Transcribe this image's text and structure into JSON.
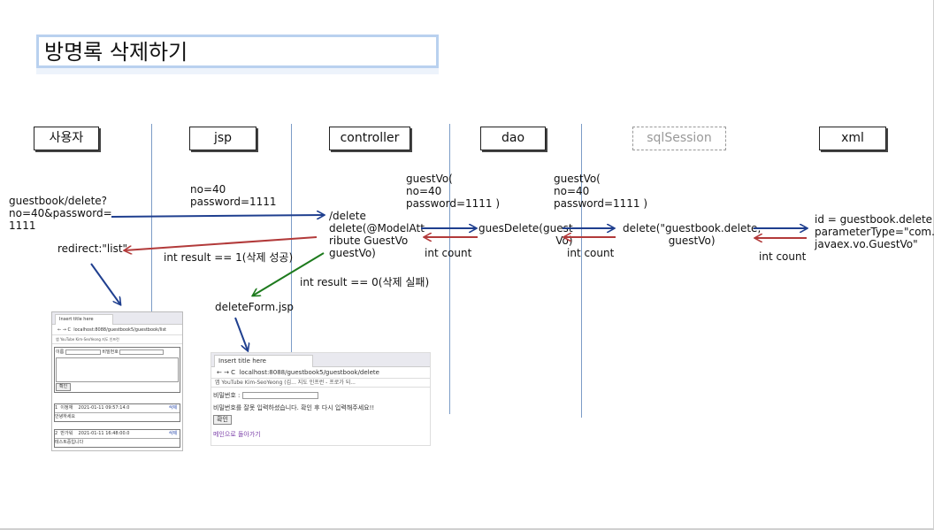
{
  "title": "방명록 삭제하기",
  "lanes": [
    "사용자",
    "jsp",
    "controller",
    "dao",
    "sqlSession",
    "xml"
  ],
  "labels": {
    "user_request": "guestbook/delete?\nno=40&password=\n1111",
    "jsp_params": "no=40\npassword=1111",
    "controller_method": "/delete\ndelete(@ModelAtt\nribute GuestVo\nguestVo)",
    "dao_params": "guestVo(\nno=40\npassword=1111 )",
    "dao_method": "guesDelete(guest\nVo)",
    "sql_params": "guestVo(\nno=40\npassword=1111 )",
    "sql_method": "delete(\"guestbook.delete,\nguestVo)",
    "xml_text": "id = guestbook.delete\nparameterType=\"com.\njavaex.vo.GuestVo\"",
    "redirect": "redirect:\"list\"",
    "result_success": "int result == 1(삭제 성공)",
    "result_fail": "int result == 0(삭제 실패)",
    "int_count_1": "int count",
    "int_count_2": "int count",
    "int_count_3": "int count",
    "delete_form": "deleteForm.jsp"
  },
  "screenshot_list": {
    "tab": "Insert title here",
    "address": "localhost:8088/guestbook5/guestbook/list",
    "bookmarks": "앱   YouTube   Kim-SeoYeong   지도   인프런",
    "name_label": "이름",
    "pw_label": "비밀번호",
    "confirm": "확인",
    "entries": [
      {
        "no": "1",
        "name": "이정재",
        "date": "2021-01-11 09:57:14.0",
        "action": "삭제",
        "text": "안녕하세요"
      },
      {
        "no": "2",
        "name": "반가워",
        "date": "2021-01-11 16:48:00.0",
        "action": "삭제",
        "text": "테스트중입니다"
      }
    ]
  },
  "screenshot_form": {
    "tab": "Insert title here",
    "address": "localhost:8088/guestbook5/guestbook/delete",
    "bookmarks": "앱   YouTube   Kim-SeoYeong (김...   지도   인프런 - 프로가 되...",
    "pw_label": "비밀번호 :",
    "error": "비밀번호를 잘못 입력하셨습니다. 확인 후 다시 입력해주세요!!",
    "confirm": "확인",
    "back_link": "메인으로 돌아가기"
  },
  "colors": {
    "blue": "#1f3f8f",
    "red": "#b23a3a",
    "green": "#1d7a1d"
  }
}
